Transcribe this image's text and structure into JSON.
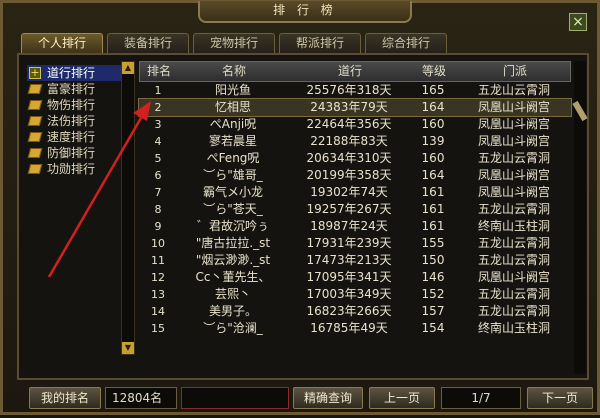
{
  "window": {
    "title": "排 行 榜"
  },
  "tabs": [
    {
      "label": "个人排行"
    },
    {
      "label": "装备排行"
    },
    {
      "label": "宠物排行"
    },
    {
      "label": "帮派排行"
    },
    {
      "label": "综合排行"
    }
  ],
  "categories": [
    {
      "label": "道行排行",
      "selected": true
    },
    {
      "label": "富豪排行"
    },
    {
      "label": "物伤排行"
    },
    {
      "label": "法伤排行"
    },
    {
      "label": "速度排行"
    },
    {
      "label": "防御排行"
    },
    {
      "label": "功勋排行"
    }
  ],
  "table": {
    "headers": [
      "排名",
      "名称",
      "道行",
      "等级",
      "门派"
    ],
    "rows": [
      {
        "rank": "1",
        "name": "阳光鱼",
        "dao": "25576年318天",
        "level": "165",
        "school": "五龙山云霄洞"
      },
      {
        "rank": "2",
        "name": "忆相思",
        "dao": "24383年79天",
        "level": "164",
        "school": "凤凰山斗阙宫"
      },
      {
        "rank": "3",
        "name": "ぺAnji呪",
        "dao": "22464年356天",
        "level": "160",
        "school": "凤凰山斗阙宫"
      },
      {
        "rank": "4",
        "name": "寥若晨星",
        "dao": "22188年83天",
        "level": "139",
        "school": "凤凰山斗阙宫"
      },
      {
        "rank": "5",
        "name": "ぺFeng呪",
        "dao": "20634年310天",
        "level": "160",
        "school": "五龙山云霄洞"
      },
      {
        "rank": "6",
        "name": "︶ら\"雄哥_",
        "dao": "20199年358天",
        "level": "164",
        "school": "凤凰山斗阙宫"
      },
      {
        "rank": "7",
        "name": "霸气メ小龙",
        "dao": "19302年74天",
        "level": "161",
        "school": "凤凰山斗阙宫"
      },
      {
        "rank": "8",
        "name": "︶ら\"苍天_",
        "dao": "19257年267天",
        "level": "161",
        "school": "五龙山云霄洞"
      },
      {
        "rank": "9",
        "name": "゛君故沉吟ぅ",
        "dao": "18987年24天",
        "level": "161",
        "school": "终南山玉柱洞"
      },
      {
        "rank": "10",
        "name": "\"唐古拉拉._st",
        "dao": "17931年239天",
        "level": "155",
        "school": "五龙山云霄洞"
      },
      {
        "rank": "11",
        "name": "\"烟云渺渺._st",
        "dao": "17473年213天",
        "level": "150",
        "school": "五龙山云霄洞"
      },
      {
        "rank": "12",
        "name": "Cc丶董先生、",
        "dao": "17095年341天",
        "level": "146",
        "school": "凤凰山斗阙宫"
      },
      {
        "rank": "13",
        "name": "芸熙丶",
        "dao": "17003年349天",
        "level": "152",
        "school": "五龙山云霄洞"
      },
      {
        "rank": "14",
        "name": "美男子。",
        "dao": "16823年266天",
        "level": "157",
        "school": "五龙山云霄洞"
      },
      {
        "rank": "15",
        "name": "︶ら\"沧澜_",
        "dao": "16785年49天",
        "level": "154",
        "school": "终南山玉柱洞"
      }
    ]
  },
  "bottom": {
    "my_rank_label": "我的排名",
    "my_rank_value": "12804名",
    "search_value": "",
    "search_button": "精确查询",
    "prev_button": "上一页",
    "page": "1/7",
    "next_button": "下一页"
  },
  "icons": {
    "close": "close-icon",
    "category": "scroll-icon",
    "expand": "plus-icon"
  },
  "colors": {
    "selected_category": "#1e2a6a",
    "highlight_row": "#3a3522",
    "annotation_arrow": "#d02020"
  }
}
